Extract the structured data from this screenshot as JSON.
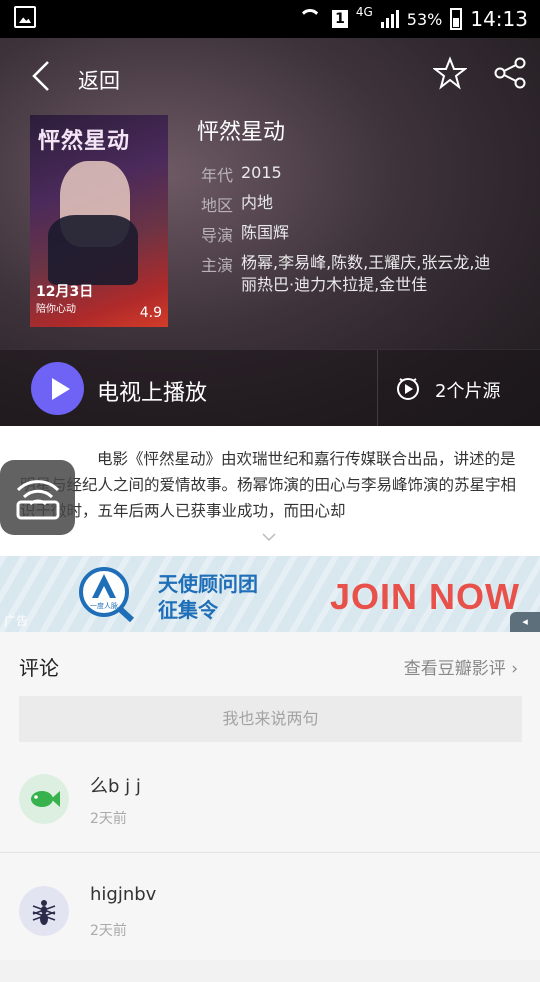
{
  "statusbar": {
    "network": "4G",
    "sim": "1",
    "battery": "53%",
    "time": "14:13"
  },
  "nav": {
    "back_label": "返回"
  },
  "movie": {
    "title": "怦然星动",
    "poster_title": "怦然星动",
    "poster_date": "12月3日",
    "poster_sub": "陪你心动",
    "rating": "4.9",
    "info": [
      {
        "label": "年代",
        "value": "2015"
      },
      {
        "label": "地区",
        "value": "内地"
      },
      {
        "label": "导演",
        "value": "陈国辉"
      },
      {
        "label": "主演",
        "value": "杨幂,李易峰,陈数,王耀庆,张云龙,迪丽热巴·迪力木拉提,金世佳"
      }
    ]
  },
  "actions": {
    "tv_play": "电视上播放",
    "sources": "2个片源"
  },
  "synopsis": "电影《怦然星动》由欢瑞世纪和嘉行传媒联合出品，讲述的是明星与经纪人之间的爱情故事。杨幂饰演的田心与李易峰饰演的苏星宇相识于微时，五年后两人已获事业成功，而田心却",
  "ad": {
    "line1": "天使顾问团",
    "line2": "征集令",
    "cta": "JOIN NOW",
    "tag": "广告",
    "logo_caption": "一度人脉"
  },
  "comments": {
    "title": "评论",
    "douban_link": "查看豆瓣影评",
    "input_placeholder": "我也来说两句",
    "items": [
      {
        "name": "么b j j",
        "time": "2天前",
        "avatar_icon": "fish-icon"
      },
      {
        "name": "higjnbv",
        "time": "2天前",
        "avatar_icon": "ant-icon"
      }
    ]
  }
}
